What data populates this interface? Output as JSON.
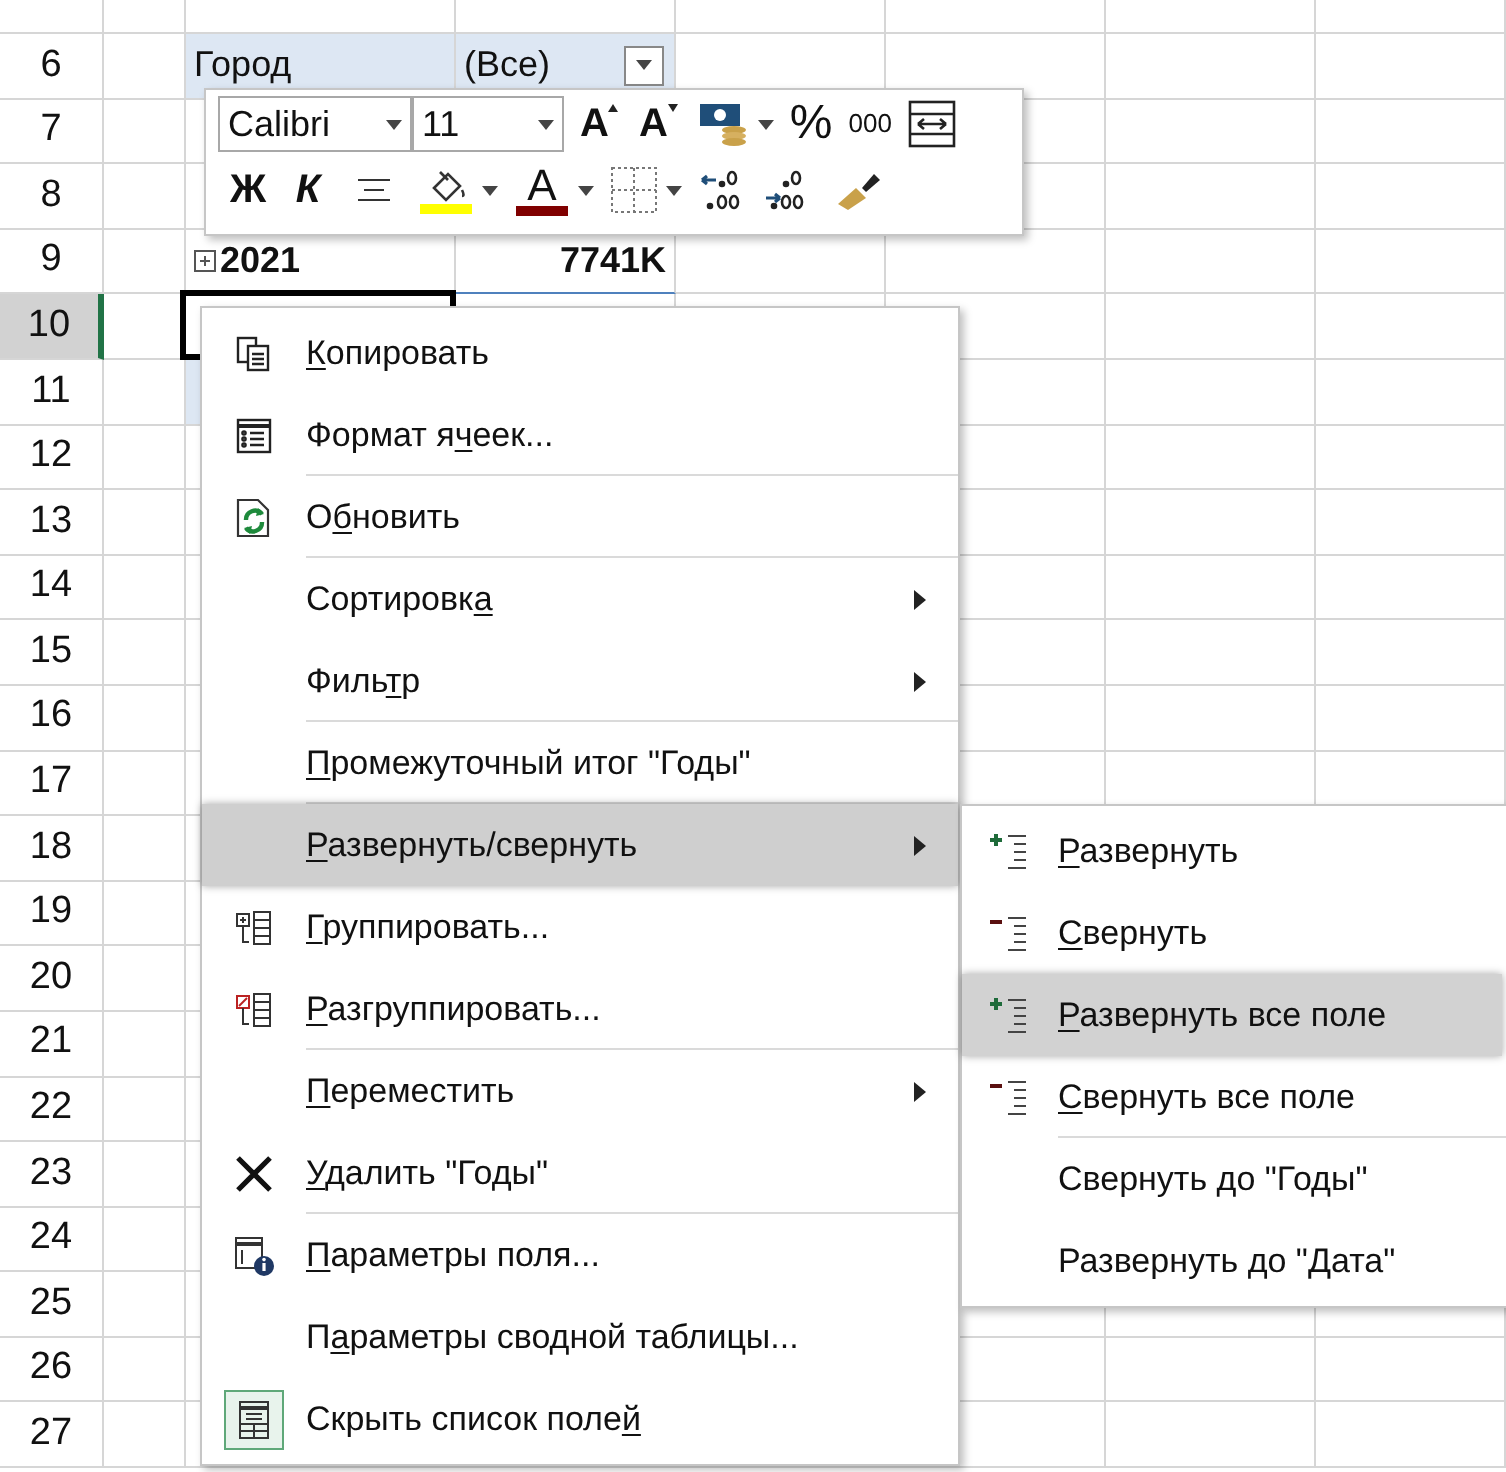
{
  "sheet": {
    "rows": [
      {
        "number": "6",
        "selected": false,
        "kind": "filter",
        "label": "Город",
        "value": "(Все)"
      },
      {
        "number": "7",
        "selected": false,
        "kind": "plain"
      },
      {
        "number": "8",
        "selected": false,
        "kind": "plain"
      },
      {
        "number": "9",
        "selected": false,
        "kind": "year",
        "label": "2021",
        "value": "7741K"
      },
      {
        "number": "10",
        "selected": true,
        "kind": "active-cell"
      },
      {
        "number": "11",
        "selected": false,
        "kind": "shaded"
      },
      {
        "number": "12",
        "selected": false,
        "kind": "plain"
      },
      {
        "number": "13",
        "selected": false,
        "kind": "plain"
      },
      {
        "number": "14",
        "selected": false,
        "kind": "plain"
      },
      {
        "number": "15",
        "selected": false,
        "kind": "plain"
      },
      {
        "number": "16",
        "selected": false,
        "kind": "plain"
      },
      {
        "number": "17",
        "selected": false,
        "kind": "plain"
      },
      {
        "number": "18",
        "selected": false,
        "kind": "plain"
      },
      {
        "number": "19",
        "selected": false,
        "kind": "plain"
      },
      {
        "number": "20",
        "selected": false,
        "kind": "plain"
      },
      {
        "number": "21",
        "selected": false,
        "kind": "plain"
      },
      {
        "number": "22",
        "selected": false,
        "kind": "plain"
      },
      {
        "number": "23",
        "selected": false,
        "kind": "plain"
      },
      {
        "number": "24",
        "selected": false,
        "kind": "plain"
      },
      {
        "number": "25",
        "selected": false,
        "kind": "plain"
      },
      {
        "number": "26",
        "selected": false,
        "kind": "plain"
      },
      {
        "number": "27",
        "selected": false,
        "kind": "plain"
      }
    ]
  },
  "mini_toolbar": {
    "font_row": [
      {
        "kind": "font-field",
        "text": "Calibri",
        "dropdown": true
      },
      {
        "kind": "size-field",
        "text": "11",
        "dropdown": true
      },
      {
        "kind": "grow-font",
        "text": "A",
        "dropdown": false
      },
      {
        "kind": "shrink-font",
        "text": "A",
        "dropdown": false
      },
      {
        "kind": "currency",
        "dropdown": true
      },
      {
        "kind": "percent",
        "text": "%",
        "dropdown": false
      },
      {
        "kind": "thousands",
        "text": "000",
        "dropdown": false
      },
      {
        "kind": "wrap",
        "dropdown": false
      }
    ],
    "format_row": [
      {
        "kind": "bold",
        "text": "Ж",
        "dropdown": false
      },
      {
        "kind": "italic",
        "text": "К",
        "dropdown": false
      },
      {
        "kind": "align",
        "dropdown": false
      },
      {
        "kind": "fill-color",
        "color": "#ffff00",
        "dropdown": true
      },
      {
        "kind": "font-color",
        "text": "A",
        "color": "#800000",
        "dropdown": true
      },
      {
        "kind": "borders",
        "dropdown": true
      },
      {
        "kind": "decrease-decimals",
        "dropdown": false
      },
      {
        "kind": "increase-decimals",
        "dropdown": false
      },
      {
        "kind": "format-painter",
        "dropdown": false
      }
    ]
  },
  "context_menu": {
    "items": [
      {
        "accel": "К",
        "rest": "опировать",
        "kind": "copy",
        "submenu": false,
        "selected": false,
        "checked": false,
        "separator_after": false
      },
      {
        "lead": "Формат я",
        "accel": "ч",
        "rest": "еек...",
        "kind": "format",
        "submenu": false,
        "selected": false,
        "checked": false,
        "separator_after": true
      },
      {
        "lead": "О",
        "accel": "б",
        "rest": "новить",
        "kind": "refresh",
        "submenu": false,
        "selected": false,
        "checked": false,
        "separator_after": true
      },
      {
        "lead": "Сортировк",
        "accel": "а",
        "kind": "plain",
        "submenu": true,
        "selected": false,
        "checked": false,
        "separator_after": false
      },
      {
        "lead": "Филь",
        "accel": "т",
        "rest": "р",
        "kind": "plain",
        "submenu": true,
        "selected": false,
        "checked": false,
        "separator_after": true
      },
      {
        "accel": "П",
        "rest": "ромежуточный итог \"Годы\"",
        "kind": "plain",
        "submenu": false,
        "selected": false,
        "checked": false,
        "separator_after": true
      },
      {
        "accel": "Р",
        "rest": "азвернуть/свернуть",
        "kind": "plain",
        "submenu": true,
        "selected": true,
        "checked": false,
        "separator_after": false
      },
      {
        "accel": "Г",
        "rest": "руппировать...",
        "kind": "group",
        "submenu": false,
        "selected": false,
        "checked": false,
        "separator_after": false
      },
      {
        "accel": "Р",
        "rest": "азгруппировать...",
        "kind": "ungroup",
        "submenu": false,
        "selected": false,
        "checked": false,
        "separator_after": true
      },
      {
        "accel": "П",
        "rest": "ереместить",
        "kind": "plain",
        "submenu": true,
        "selected": false,
        "checked": false,
        "separator_after": false
      },
      {
        "accel": "У",
        "rest": "далить \"Годы\"",
        "kind": "delete",
        "submenu": false,
        "selected": false,
        "checked": false,
        "separator_after": true
      },
      {
        "accel": "П",
        "rest": "араметры поля...",
        "kind": "field-settings",
        "submenu": false,
        "selected": false,
        "checked": false,
        "separator_after": false
      },
      {
        "lead": "П",
        "accel": "а",
        "rest": "раметры сводной таблицы...",
        "kind": "plain",
        "submenu": false,
        "selected": false,
        "checked": false,
        "separator_after": false
      },
      {
        "lead": "Скрыть список поле",
        "accel": "й",
        "kind": "field-list",
        "submenu": false,
        "selected": false,
        "checked": true,
        "separator_after": false
      }
    ]
  },
  "submenu": {
    "items": [
      {
        "accel": "Р",
        "rest": "азвернуть",
        "kind": "expand",
        "selected": false,
        "separator_after": false
      },
      {
        "accel": "С",
        "rest": "вернуть",
        "kind": "collapse",
        "selected": false,
        "separator_after": false
      },
      {
        "accel": "Р",
        "rest": "азвернуть все поле",
        "kind": "expand",
        "selected": true,
        "separator_after": false
      },
      {
        "accel": "С",
        "rest": "вернуть все поле",
        "kind": "collapse",
        "selected": false,
        "separator_after": true
      },
      {
        "lead": "Свернуть до \"Годы\"",
        "kind": "plain",
        "selected": false,
        "separator_after": false
      },
      {
        "lead": "Развернуть до \"Дата\"",
        "kind": "plain",
        "selected": false,
        "separator_after": false
      }
    ]
  }
}
